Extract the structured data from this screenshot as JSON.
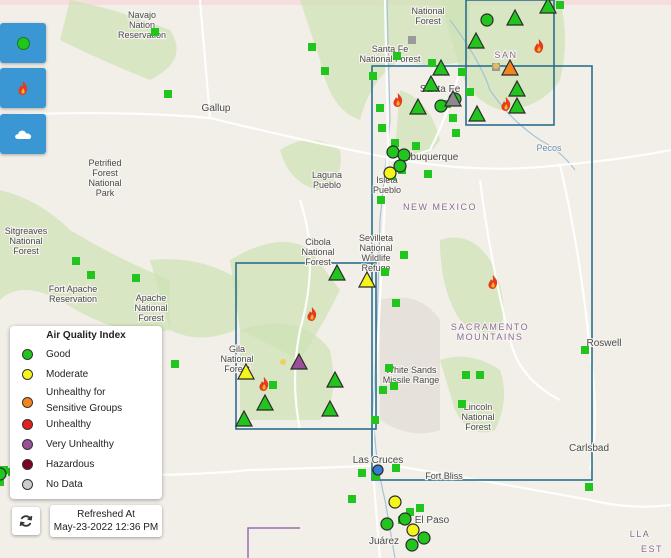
{
  "controls": {
    "buttons": [
      {
        "name": "air-quality-layer-button",
        "icon": "green-dot-icon"
      },
      {
        "name": "fire-layer-button",
        "icon": "fire-icon"
      },
      {
        "name": "smoke-layer-button",
        "icon": "cloud-icon"
      }
    ]
  },
  "legend": {
    "title": "Air Quality Index",
    "items": [
      {
        "label": "Good",
        "color": "#22c41e"
      },
      {
        "label": "Moderate",
        "color": "#f5f51b"
      },
      {
        "label": "Unhealthy for Sensitive Groups",
        "color": "#f5841f"
      },
      {
        "label": "Unhealthy",
        "color": "#e61e1e"
      },
      {
        "label": "Very Unhealthy",
        "color": "#9b4f96"
      },
      {
        "label": "Hazardous",
        "color": "#7e0023"
      },
      {
        "label": "No Data",
        "color": "#cccccc"
      }
    ]
  },
  "refresh": {
    "label": "Refreshed At",
    "timestamp": "May-23-2022 12:36 PM"
  },
  "map": {
    "place_labels": [
      "Navajo Nation Reservation",
      "National Forest",
      "Santa Fe National Forest",
      "Santa Fe",
      "Gallup",
      "Albuquerque",
      "Petrified Forest National Park",
      "Laguna Pueblo",
      "Isleta Pueblo",
      "NEW MEXICO",
      "Pecos",
      "Sitgreaves National Forest",
      "Fort Apache Reservation",
      "Apache National Forest",
      "Cibola National Forest",
      "Sevilleta National Wildlife Refuge",
      "SACRAMENTO MOUNTAINS",
      "Roswell",
      "Gila National Forest",
      "White Sands Missile Range",
      "Lincoln National Forest",
      "Las Cruces",
      "Carlsbad",
      "Fort Bliss",
      "El Paso",
      "Juárez",
      "LLA",
      "EST",
      "SAN"
    ],
    "colors": {
      "land": "#f2efe9",
      "forest": "#cfe3b5",
      "desert": "#e4dfd8",
      "box": "#2a6f8e",
      "water": "#a5c3d8",
      "good": "#22c41e",
      "moderate": "#f5f51b",
      "usg": "#f5841f",
      "very_unhealthy": "#9b4f96",
      "no_data": "#9a9a9a"
    }
  }
}
